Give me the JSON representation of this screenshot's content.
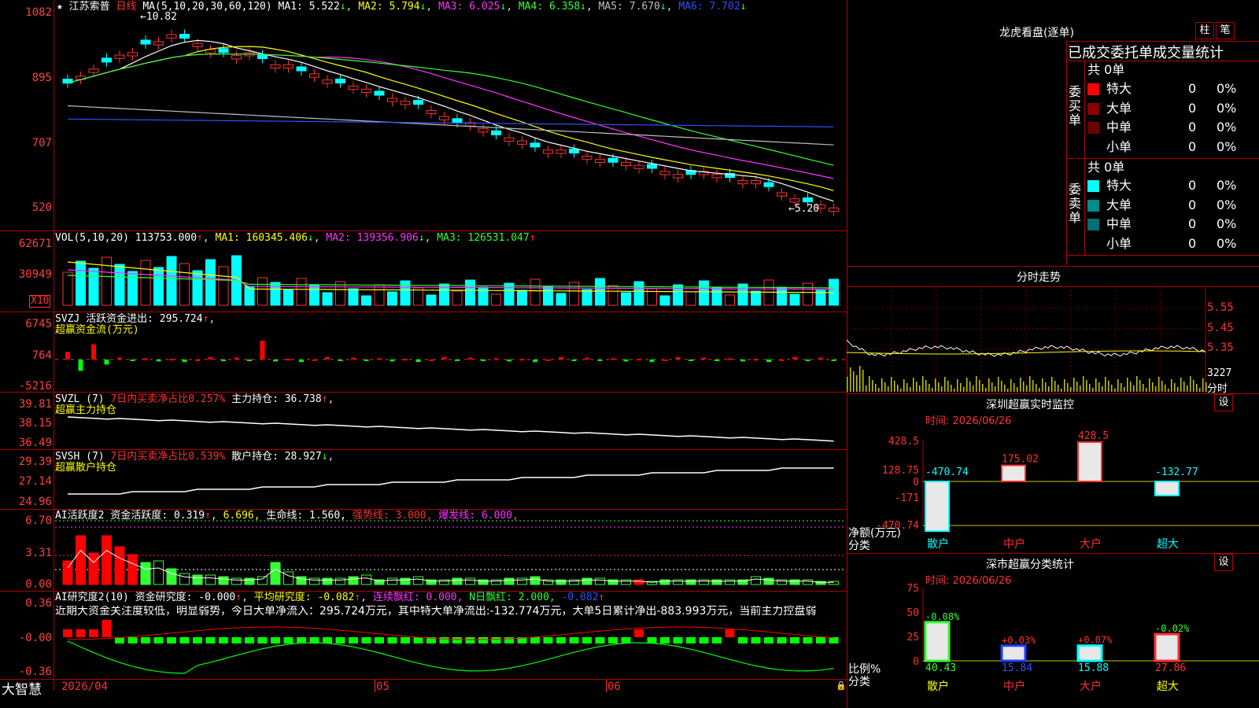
{
  "main_chart": {
    "stock_name": "江苏索普",
    "period": "日线",
    "ma_label": "MA(5,10,20,30,60,120)",
    "ma1": "MA1: 5.522",
    "ma2": "MA2: 5.794",
    "ma3": "MA3: 6.025",
    "ma4": "MA4: 6.358",
    "ma5": "MA5: 7.670",
    "ma6": "MA6: 7.702",
    "high_mark": "10.82",
    "low_mark": "5.20",
    "y_ticks": [
      "1082",
      "895",
      "707",
      "520"
    ]
  },
  "vol_panel": {
    "label": "VOL(5,10,20)",
    "value": "113753.000",
    "ma1": "MA1: 160345.406",
    "ma2": "MA2: 139356.906",
    "ma3": "MA3: 126531.047",
    "y_ticks": [
      "62671",
      "30949"
    ],
    "unit": "X10"
  },
  "svzj_panel": {
    "label": "SVZJ",
    "item": "活跃资金进出: 295.724",
    "subtitle": "超赢资金流(万元)",
    "y_ticks": [
      "6745",
      "764",
      "-5216"
    ]
  },
  "svzl_panel": {
    "label": "SVZL (7)",
    "item1": "7日内买卖净占比0.257%",
    "item2": "主力持仓: 36.738",
    "subtitle": "超赢主力持仓",
    "y_ticks": [
      "39.81",
      "38.15",
      "36.49"
    ]
  },
  "svsh_panel": {
    "label": "SVSH (7)",
    "item1": "7日内买卖净占比0.539%",
    "item2": "散户持仓: 28.927",
    "subtitle": "超赢散户持仓",
    "y_ticks": [
      "29.39",
      "27.14",
      "24.96"
    ]
  },
  "ai_active_panel": {
    "label": "AI活跃度2",
    "item1": "资金活跃度: 0.319",
    "item2": "6.696,",
    "item3": "生命线: 1.560,",
    "item4": "强势线: 3.000,",
    "item5": "爆发线: 6.000,",
    "y_ticks": [
      "6.70",
      "3.31",
      "0.00"
    ]
  },
  "ai_research_panel": {
    "label": "AI研究度2(10)",
    "item1": "资金研究度: -0.000",
    "item2": "平均研究度: -0.082",
    "item3": "连续飘红: 0.000,",
    "item4": "N日飘红: 2.000,",
    "item5": "-0.082",
    "commentary": "近期大资金关注度较低，明显弱势，今日大单净流入：295.724万元，其中特大单净流出:-132.774万元，大单5日累计净出-883.993万元，当前主力控盘弱",
    "y_ticks": [
      "0.36",
      "-0.00",
      "-0.36"
    ]
  },
  "bottom_bar": {
    "brand": "大智慧",
    "dates": [
      "2026/04",
      "05",
      "06"
    ]
  },
  "dragon_tiger": {
    "title": "龙虎看盘(逐单)",
    "btn_bar": "柱",
    "btn_pen": "笔",
    "subtitle": "已成交委托单成交量统计",
    "buy_side_label": [
      "委",
      "买",
      "单"
    ],
    "sell_side_label": [
      "委",
      "卖",
      "单"
    ],
    "buy_total": "共 0单",
    "sell_total": "共 0单",
    "buy_rows": [
      {
        "name": "特大",
        "count": "0",
        "pct": "0%",
        "color": "#ff0000"
      },
      {
        "name": "大单",
        "count": "0",
        "pct": "0%",
        "color": "#8b0000"
      },
      {
        "name": "中单",
        "count": "0",
        "pct": "0%",
        "color": "#6b0000"
      },
      {
        "name": "小单",
        "count": "0",
        "pct": "0%",
        "color": ""
      }
    ],
    "sell_rows": [
      {
        "name": "特大",
        "count": "0",
        "pct": "0%",
        "color": "#00ffff"
      },
      {
        "name": "大单",
        "count": "0",
        "pct": "0%",
        "color": "#008b8b"
      },
      {
        "name": "中单",
        "count": "0",
        "pct": "0%",
        "color": "#007070"
      },
      {
        "name": "小单",
        "count": "0",
        "pct": "0%",
        "color": ""
      }
    ]
  },
  "intraday": {
    "title": "分时走势",
    "y_ticks": [
      "5.55",
      "5.45",
      "5.35"
    ],
    "vol_value": "3227",
    "unit": "分时"
  },
  "sz_monitor": {
    "title": "深圳超赢实时监控",
    "settings": "设",
    "time_label": "时间: 2026/06/26",
    "y_ticks": [
      "428.5",
      "128.75",
      "0",
      "-171",
      "-470.74"
    ],
    "axis_title": "净额(万元)",
    "axis_cat": "分类",
    "categories": [
      "散户",
      "中户",
      "大户",
      "超大"
    ],
    "values": [
      -470.74,
      175.02,
      428.5,
      -132.77
    ],
    "labels": [
      "-470.74",
      "175.02",
      "428.5",
      "-132.77"
    ]
  },
  "sz_classify": {
    "title": "深市超赢分类统计",
    "settings": "设",
    "time_label": "时间: 2026/06/26",
    "y_ticks": [
      "75",
      "50",
      "25",
      "0"
    ],
    "axis_title": "比例%",
    "axis_cat": "分类",
    "categories": [
      "散户",
      "中户",
      "大户",
      "超大"
    ],
    "values": [
      40.43,
      15.84,
      15.88,
      27.86
    ],
    "changes": [
      "-0.08%",
      "+0.03%",
      "+0.07%",
      "-0.02%"
    ]
  }
}
